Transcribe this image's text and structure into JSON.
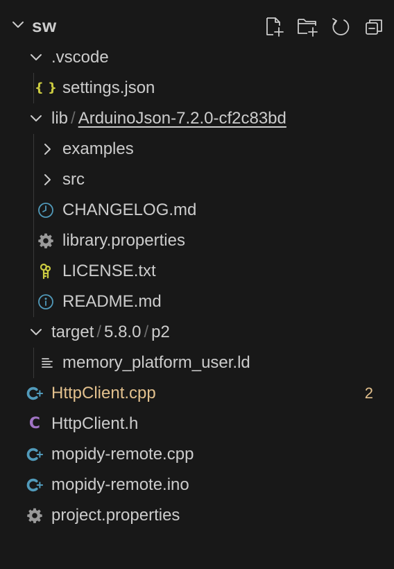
{
  "root": {
    "title": "sw",
    "actions": [
      {
        "name": "new-file-icon",
        "tooltip": "New File..."
      },
      {
        "name": "new-folder-icon",
        "tooltip": "New Folder..."
      },
      {
        "name": "refresh-icon",
        "tooltip": "Refresh Explorer"
      },
      {
        "name": "collapse-all-icon",
        "tooltip": "Collapse Folders in Explorer"
      }
    ]
  },
  "tree": {
    "vscode": {
      "label": ".vscode"
    },
    "settings": {
      "label": "settings.json",
      "icon_text": "{ }"
    },
    "lib": {
      "label": "lib",
      "sep": "/",
      "sub": "ArduinoJson-7.2.0-cf2c83bd"
    },
    "examples": {
      "label": "examples"
    },
    "src": {
      "label": "src"
    },
    "changelog": {
      "label": "CHANGELOG.md"
    },
    "library_props": {
      "label": "library.properties"
    },
    "license": {
      "label": "LICENSE.txt"
    },
    "readme": {
      "label": "README.md"
    },
    "target": {
      "label": "target",
      "sep1": "/",
      "p1": "5.8.0",
      "sep2": "/",
      "p2": "p2"
    },
    "memory": {
      "label": "memory_platform_user.ld"
    },
    "httpclient_cpp": {
      "label": "HttpClient.cpp",
      "badge": "2"
    },
    "httpclient_h": {
      "label": "HttpClient.h",
      "icon_text": "C"
    },
    "mopidy_cpp": {
      "label": "mopidy-remote.cpp"
    },
    "mopidy_ino": {
      "label": "mopidy-remote.ino"
    },
    "project_props": {
      "label": "project.properties"
    }
  },
  "colors": {
    "background": "#181818",
    "text": "#cccccc",
    "modified": "#e2c08d",
    "json_icon": "#cbcb41",
    "cpp_icon": "#519aba",
    "c_icon": "#a074c4",
    "info_icon": "#519aba",
    "key_icon": "#cbcb41",
    "gear_icon": "#999999"
  }
}
